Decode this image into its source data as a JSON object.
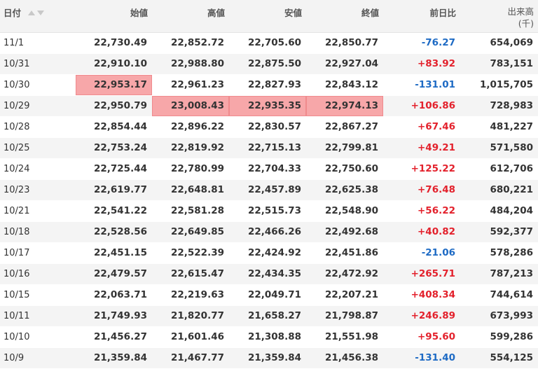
{
  "headers": {
    "date": "日付",
    "open": "始値",
    "high": "高値",
    "low": "安値",
    "close": "終値",
    "change": "前日比",
    "volume": "出来高",
    "volume_unit": "(千)"
  },
  "colors": {
    "up": "#e3212c",
    "down": "#1d6ac4",
    "highlight": "#f7a7a9"
  },
  "rows": [
    {
      "date": "11/1",
      "open": "22,730.49",
      "high": "22,852.72",
      "low": "22,705.60",
      "close": "22,850.77",
      "change": "-76.27",
      "volume": "654,069"
    },
    {
      "date": "10/31",
      "open": "22,910.10",
      "high": "22,988.80",
      "low": "22,875.50",
      "close": "22,927.04",
      "change": "+83.92",
      "volume": "783,151"
    },
    {
      "date": "10/30",
      "open": "22,953.17",
      "high": "22,961.23",
      "low": "22,827.93",
      "close": "22,843.12",
      "change": "-131.01",
      "volume": "1,015,705"
    },
    {
      "date": "10/29",
      "open": "22,950.79",
      "high": "23,008.43",
      "low": "22,935.35",
      "close": "22,974.13",
      "change": "+106.86",
      "volume": "728,983"
    },
    {
      "date": "10/28",
      "open": "22,854.44",
      "high": "22,896.22",
      "low": "22,830.57",
      "close": "22,867.27",
      "change": "+67.46",
      "volume": "481,227"
    },
    {
      "date": "10/25",
      "open": "22,753.24",
      "high": "22,819.92",
      "low": "22,715.13",
      "close": "22,799.81",
      "change": "+49.21",
      "volume": "571,580"
    },
    {
      "date": "10/24",
      "open": "22,725.44",
      "high": "22,780.99",
      "low": "22,704.33",
      "close": "22,750.60",
      "change": "+125.22",
      "volume": "612,706"
    },
    {
      "date": "10/23",
      "open": "22,619.77",
      "high": "22,648.81",
      "low": "22,457.89",
      "close": "22,625.38",
      "change": "+76.48",
      "volume": "680,221"
    },
    {
      "date": "10/21",
      "open": "22,541.22",
      "high": "22,581.28",
      "low": "22,515.73",
      "close": "22,548.90",
      "change": "+56.22",
      "volume": "484,204"
    },
    {
      "date": "10/18",
      "open": "22,528.56",
      "high": "22,649.85",
      "low": "22,466.26",
      "close": "22,492.68",
      "change": "+40.82",
      "volume": "592,377"
    },
    {
      "date": "10/17",
      "open": "22,451.15",
      "high": "22,522.39",
      "low": "22,424.92",
      "close": "22,451.86",
      "change": "-21.06",
      "volume": "578,286"
    },
    {
      "date": "10/16",
      "open": "22,479.57",
      "high": "22,615.47",
      "low": "22,434.35",
      "close": "22,472.92",
      "change": "+265.71",
      "volume": "787,213"
    },
    {
      "date": "10/15",
      "open": "22,063.71",
      "high": "22,219.63",
      "low": "22,049.71",
      "close": "22,207.21",
      "change": "+408.34",
      "volume": "744,614"
    },
    {
      "date": "10/11",
      "open": "21,749.93",
      "high": "21,820.77",
      "low": "21,658.27",
      "close": "21,798.87",
      "change": "+246.89",
      "volume": "673,993"
    },
    {
      "date": "10/10",
      "open": "21,456.27",
      "high": "21,601.46",
      "low": "21,308.88",
      "close": "21,551.98",
      "change": "+95.60",
      "volume": "599,286"
    },
    {
      "date": "10/9",
      "open": "21,359.84",
      "high": "21,467.77",
      "low": "21,359.84",
      "close": "21,456.38",
      "change": "-131.40",
      "volume": "554,125"
    }
  ],
  "highlighted_cells": [
    {
      "row": 2,
      "col": "open"
    },
    {
      "row": 3,
      "col": "high"
    },
    {
      "row": 3,
      "col": "low"
    },
    {
      "row": 3,
      "col": "close"
    }
  ]
}
